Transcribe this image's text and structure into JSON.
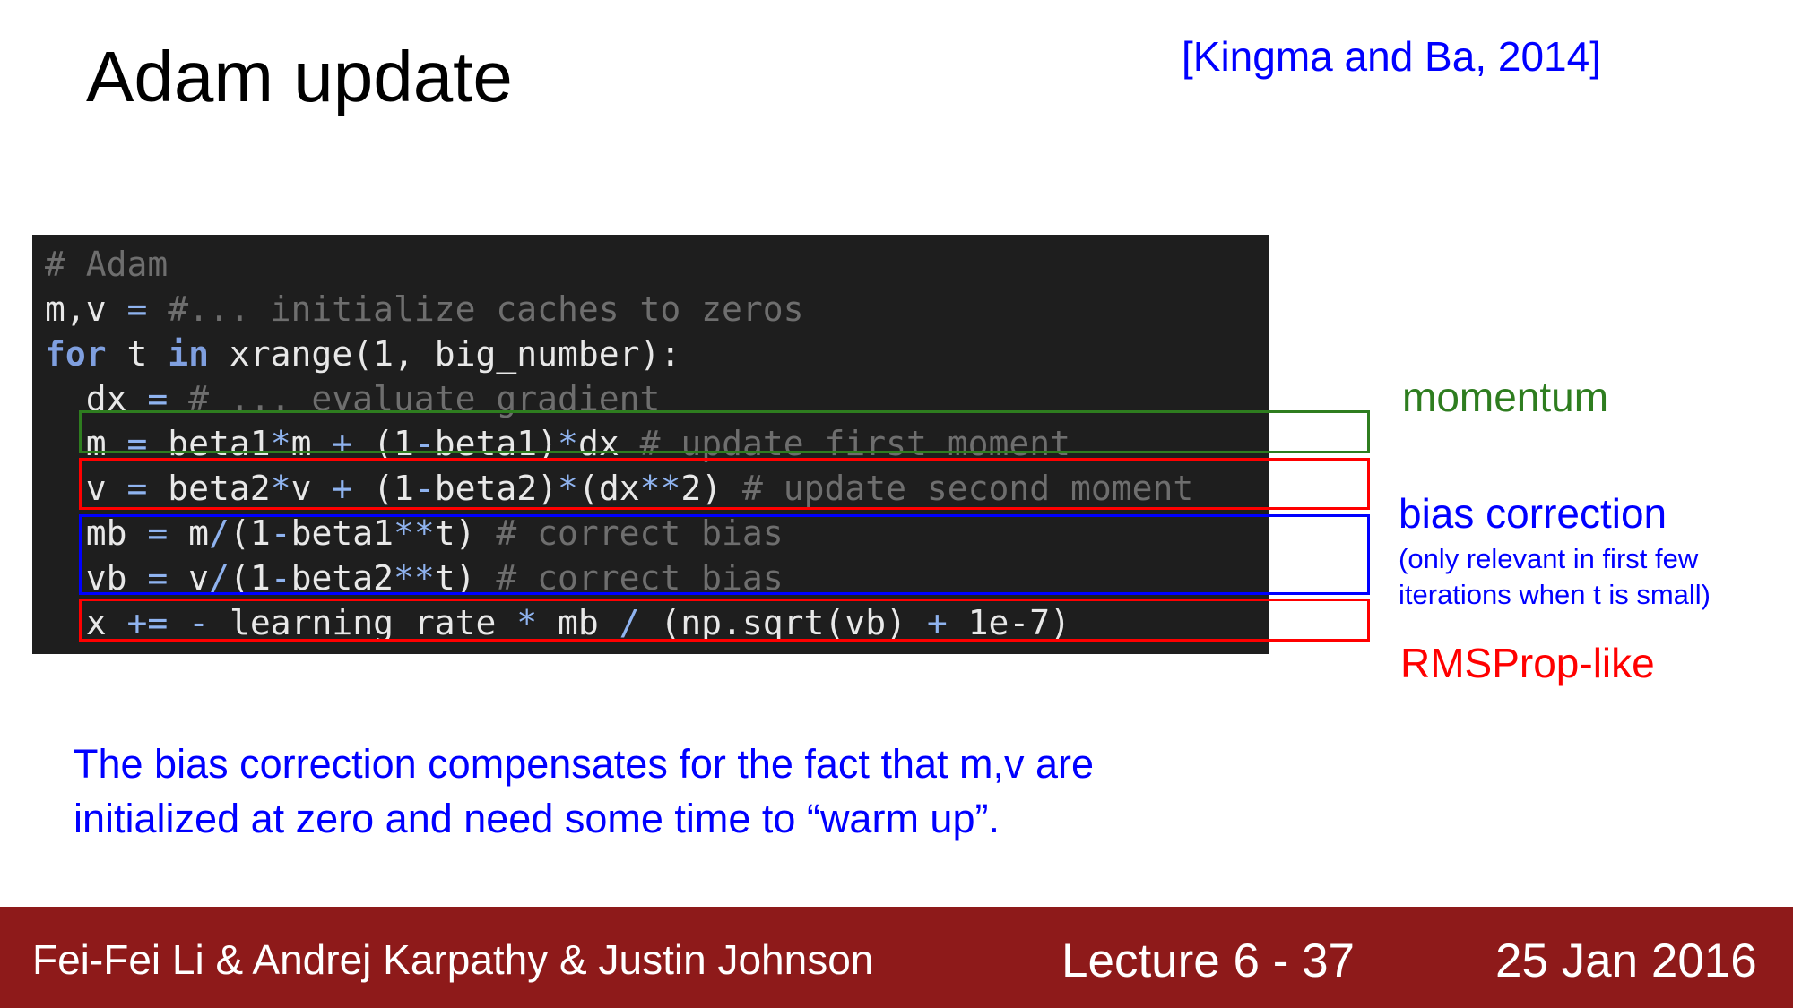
{
  "slide": {
    "title": "Adam update",
    "citation": "[Kingma and Ba, 2014]"
  },
  "code": {
    "lines": [
      [
        {
          "t": "# Adam",
          "c": "comment"
        }
      ],
      [
        {
          "t": "m,v ",
          "c": "plain"
        },
        {
          "t": "=",
          "c": "op"
        },
        {
          "t": " #... initialize caches to zeros",
          "c": "comment"
        }
      ],
      [
        {
          "t": "for",
          "c": "kw"
        },
        {
          "t": " t ",
          "c": "plain"
        },
        {
          "t": "in",
          "c": "kw"
        },
        {
          "t": " xrange(1, big_number):",
          "c": "plain"
        }
      ],
      [
        {
          "t": "  dx ",
          "c": "plain"
        },
        {
          "t": "=",
          "c": "op"
        },
        {
          "t": " # ... evaluate gradient",
          "c": "comment"
        }
      ],
      [
        {
          "t": "  m ",
          "c": "plain"
        },
        {
          "t": "=",
          "c": "op"
        },
        {
          "t": " beta1",
          "c": "plain"
        },
        {
          "t": "*",
          "c": "op"
        },
        {
          "t": "m ",
          "c": "plain"
        },
        {
          "t": "+",
          "c": "op"
        },
        {
          "t": " (1",
          "c": "plain"
        },
        {
          "t": "-",
          "c": "op"
        },
        {
          "t": "beta1)",
          "c": "plain"
        },
        {
          "t": "*",
          "c": "op"
        },
        {
          "t": "dx ",
          "c": "plain"
        },
        {
          "t": "# update first moment",
          "c": "comment"
        }
      ],
      [
        {
          "t": "  v ",
          "c": "plain"
        },
        {
          "t": "=",
          "c": "op"
        },
        {
          "t": " beta2",
          "c": "plain"
        },
        {
          "t": "*",
          "c": "op"
        },
        {
          "t": "v ",
          "c": "plain"
        },
        {
          "t": "+",
          "c": "op"
        },
        {
          "t": " (1",
          "c": "plain"
        },
        {
          "t": "-",
          "c": "op"
        },
        {
          "t": "beta2)",
          "c": "plain"
        },
        {
          "t": "*",
          "c": "op"
        },
        {
          "t": "(dx",
          "c": "plain"
        },
        {
          "t": "**",
          "c": "op"
        },
        {
          "t": "2) ",
          "c": "plain"
        },
        {
          "t": "# update second moment",
          "c": "comment"
        }
      ],
      [
        {
          "t": "  mb ",
          "c": "plain"
        },
        {
          "t": "=",
          "c": "op"
        },
        {
          "t": " m",
          "c": "plain"
        },
        {
          "t": "/",
          "c": "op"
        },
        {
          "t": "(1",
          "c": "plain"
        },
        {
          "t": "-",
          "c": "op"
        },
        {
          "t": "beta1",
          "c": "plain"
        },
        {
          "t": "**",
          "c": "op"
        },
        {
          "t": "t) ",
          "c": "plain"
        },
        {
          "t": "# correct bias",
          "c": "comment"
        }
      ],
      [
        {
          "t": "  vb ",
          "c": "plain"
        },
        {
          "t": "=",
          "c": "op"
        },
        {
          "t": " v",
          "c": "plain"
        },
        {
          "t": "/",
          "c": "op"
        },
        {
          "t": "(1",
          "c": "plain"
        },
        {
          "t": "-",
          "c": "op"
        },
        {
          "t": "beta2",
          "c": "plain"
        },
        {
          "t": "**",
          "c": "op"
        },
        {
          "t": "t) ",
          "c": "plain"
        },
        {
          "t": "# correct bias",
          "c": "comment"
        }
      ],
      [
        {
          "t": "  x ",
          "c": "plain"
        },
        {
          "t": "+=",
          "c": "op"
        },
        {
          "t": " ",
          "c": "plain"
        },
        {
          "t": "-",
          "c": "op"
        },
        {
          "t": " learning_rate ",
          "c": "plain"
        },
        {
          "t": "*",
          "c": "op"
        },
        {
          "t": " mb ",
          "c": "plain"
        },
        {
          "t": "/",
          "c": "op"
        },
        {
          "t": " (np.sqrt(vb) ",
          "c": "plain"
        },
        {
          "t": "+",
          "c": "op"
        },
        {
          "t": " 1e-7)",
          "c": "plain"
        }
      ]
    ]
  },
  "annotations": {
    "momentum": "momentum",
    "bias_correction": "bias correction",
    "bias_note_line1": "(only relevant in first few",
    "bias_note_line2": "iterations when t is small)",
    "rmsprop": "RMSProp-like"
  },
  "note": {
    "line1": "The bias correction compensates for the fact that m,v are",
    "line2": "initialized at zero and need some time to “warm up”."
  },
  "footer": {
    "authors": "Fei-Fei Li & Andrej Karpathy & Justin Johnson",
    "lecture": "Lecture 6 - 37",
    "date": "25 Jan 2016"
  },
  "colors": {
    "momentum": "#2e7d1f",
    "rmsprop": "#ff0000",
    "bias": "#0000ff",
    "footer_bg": "#8e1a1a",
    "code_bg": "#1e1e1e"
  }
}
